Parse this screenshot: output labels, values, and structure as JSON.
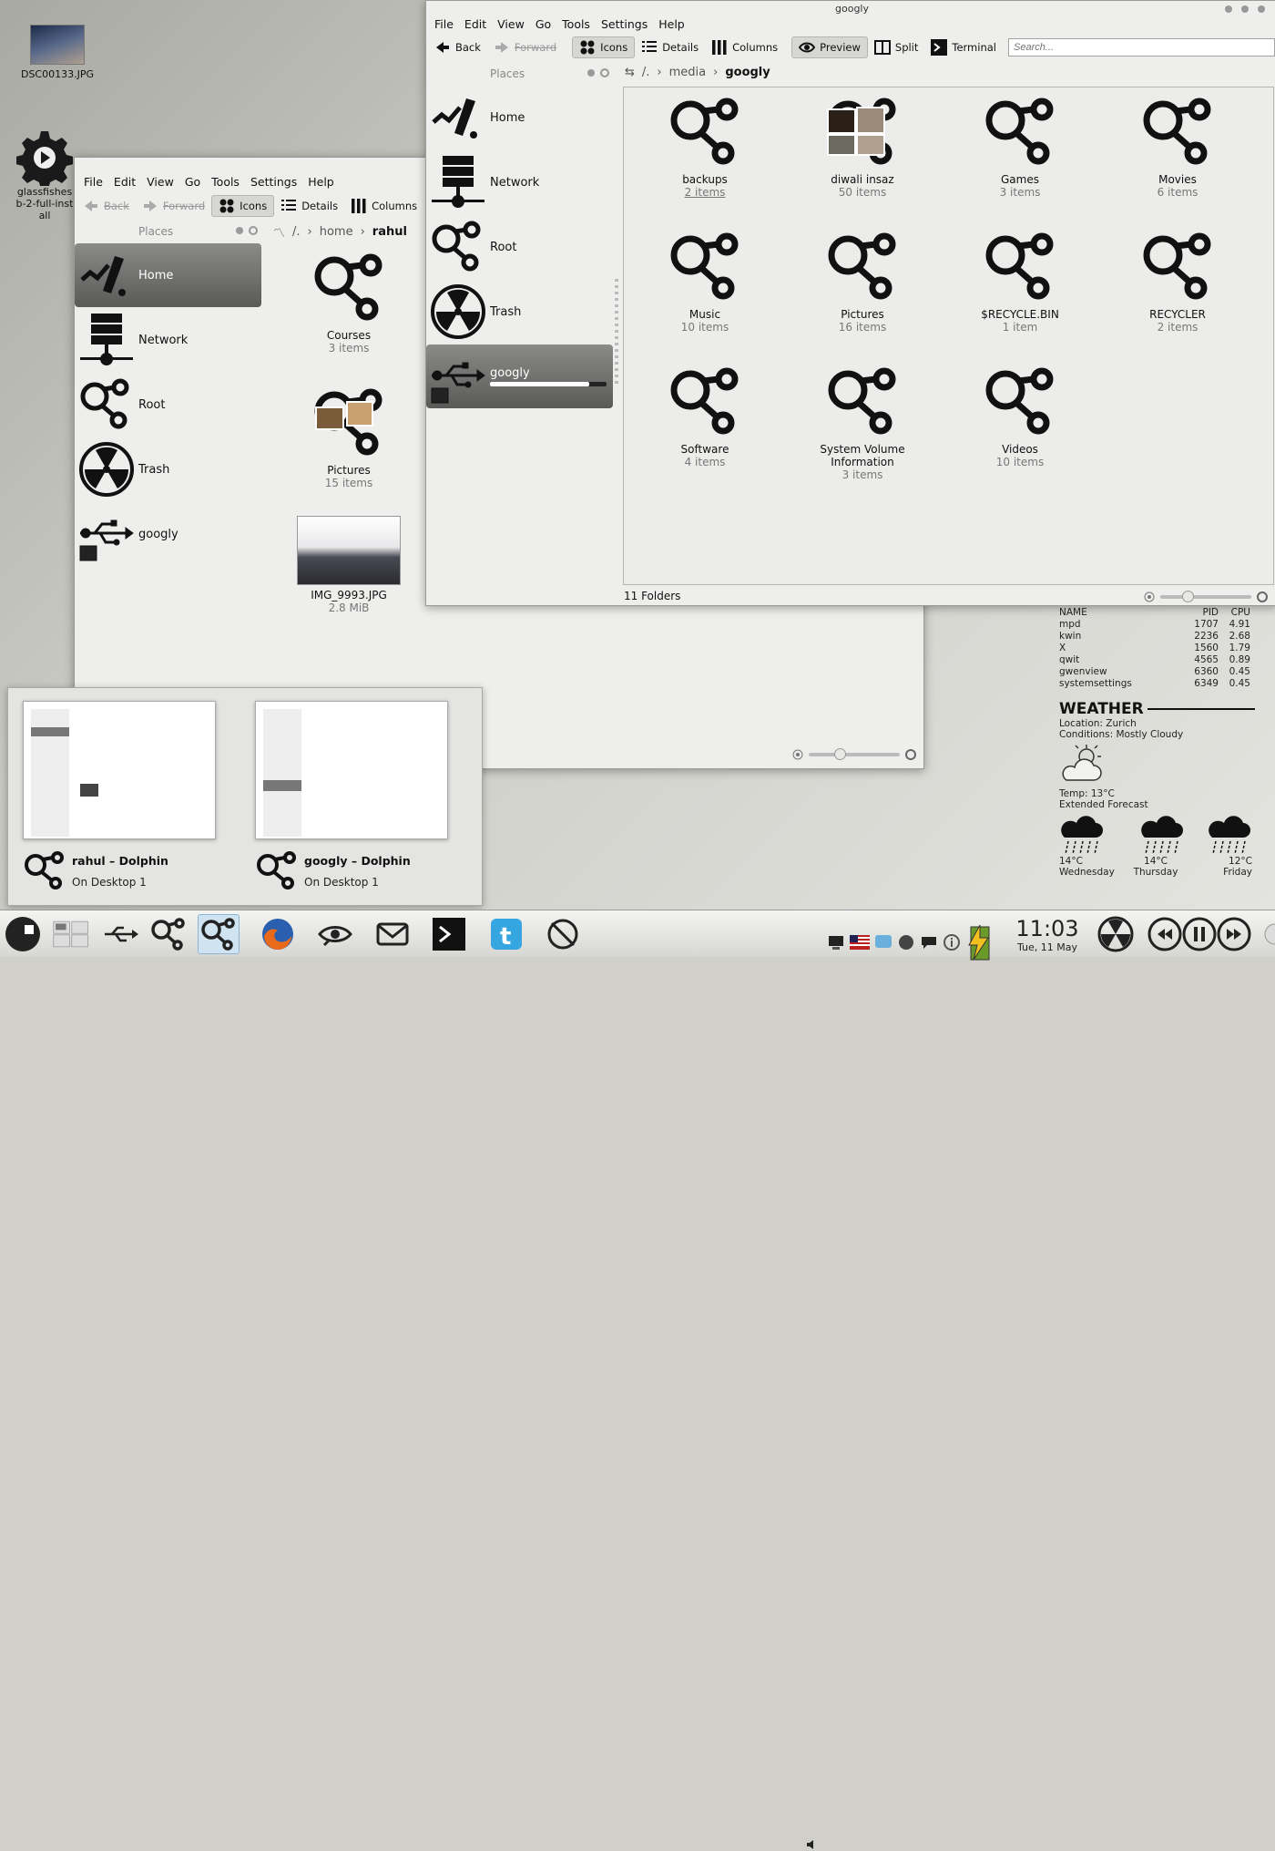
{
  "desktop": {
    "icons": [
      {
        "label": "DSC00133.JPG"
      },
      {
        "label": "glassfishesb-2-full-install"
      }
    ]
  },
  "back_window": {
    "menu": [
      "File",
      "Edit",
      "View",
      "Go",
      "Tools",
      "Settings",
      "Help"
    ],
    "toolbar": {
      "back": "Back",
      "forward": "Forward",
      "icons": "Icons",
      "details": "Details",
      "columns": "Columns"
    },
    "places_header": "Places",
    "places": [
      {
        "label": "Home",
        "icon": "home-icon",
        "selected": true
      },
      {
        "label": "Network",
        "icon": "network-icon"
      },
      {
        "label": "Root",
        "icon": "root-icon"
      },
      {
        "label": "Trash",
        "icon": "trash-icon"
      },
      {
        "label": "googly",
        "icon": "usb-icon"
      }
    ],
    "breadcrumb": {
      "root": "/.",
      "parts": [
        "home"
      ],
      "current": "rahul"
    },
    "items": [
      {
        "name": "Courses",
        "sub": "3 items"
      },
      {
        "name": "Pictures",
        "sub": "15 items"
      },
      {
        "name": "IMG_9993.JPG",
        "sub": "2.8 MiB"
      }
    ]
  },
  "front_window": {
    "title": "googly",
    "menu": [
      "File",
      "Edit",
      "View",
      "Go",
      "Tools",
      "Settings",
      "Help"
    ],
    "toolbar": {
      "back": "Back",
      "forward": "Forward",
      "icons": "Icons",
      "details": "Details",
      "columns": "Columns",
      "preview": "Preview",
      "split": "Split",
      "terminal": "Terminal"
    },
    "search": {
      "placeholder": "Search..."
    },
    "places_header": "Places",
    "places": [
      {
        "label": "Home",
        "icon": "home-icon"
      },
      {
        "label": "Network",
        "icon": "network-icon"
      },
      {
        "label": "Root",
        "icon": "root-icon"
      },
      {
        "label": "Trash",
        "icon": "trash-icon"
      },
      {
        "label": "googly",
        "icon": "usb-icon",
        "selected": true,
        "usage": 0.85
      }
    ],
    "breadcrumb": {
      "root": "/.",
      "parts": [
        "media"
      ],
      "current": "googly"
    },
    "items": [
      {
        "name": "backups",
        "sub": "2 items"
      },
      {
        "name": "diwali insaz",
        "sub": "50 items"
      },
      {
        "name": "Games",
        "sub": "3 items"
      },
      {
        "name": "Movies",
        "sub": "6 items"
      },
      {
        "name": "Music",
        "sub": "10 items"
      },
      {
        "name": "Pictures",
        "sub": "16 items"
      },
      {
        "name": "$RECYCLE.BIN",
        "sub": "1 item"
      },
      {
        "name": "RECYCLER",
        "sub": "2 items"
      },
      {
        "name": "Software",
        "sub": "4 items"
      },
      {
        "name": "System Volume Information",
        "sub": "3 items"
      },
      {
        "name": "Videos",
        "sub": "10 items"
      }
    ],
    "status": "11 Folders",
    "zoom_level": 0.3
  },
  "process_widget": {
    "headers": {
      "name": "NAME",
      "pid": "PID",
      "cpu": "CPU"
    },
    "rows": [
      {
        "name": "mpd",
        "pid": "1707",
        "cpu": "4.91"
      },
      {
        "name": "kwin",
        "pid": "2236",
        "cpu": "2.68"
      },
      {
        "name": "X",
        "pid": "1560",
        "cpu": "1.79"
      },
      {
        "name": "qwit",
        "pid": "4565",
        "cpu": "0.89"
      },
      {
        "name": "gwenview",
        "pid": "6360",
        "cpu": "0.45"
      },
      {
        "name": "systemsettings",
        "pid": "6349",
        "cpu": "0.45"
      }
    ]
  },
  "weather": {
    "title": "WEATHER",
    "location": "Location: Zurich",
    "conditions": "Conditions: Mostly Cloudy",
    "temp": "Temp: 13°C",
    "forecast_label": "Extended Forecast",
    "forecast": [
      {
        "temp": "14°C",
        "day": "Wednesday"
      },
      {
        "temp": "14°C",
        "day": "Thursday"
      },
      {
        "temp": "12°C",
        "day": "Friday"
      }
    ]
  },
  "switcher": {
    "windows": [
      {
        "title": "rahul – Dolphin",
        "desktop": "On Desktop 1"
      },
      {
        "title": "googly – Dolphin",
        "desktop": "On Desktop 1"
      }
    ]
  },
  "taskbar": {
    "clock_time": "11:03",
    "clock_date": "Tue, 11 May"
  }
}
